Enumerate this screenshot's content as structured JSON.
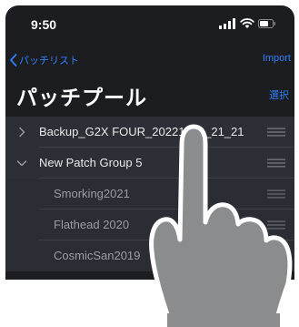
{
  "status": {
    "time": "9:50"
  },
  "nav": {
    "back_label": "パッチリスト",
    "import_label": "Import"
  },
  "header": {
    "title": "パッチプール",
    "select_label": "選択"
  },
  "patches": [
    {
      "label": "Backup_G2X FOUR_20221230_21_21",
      "expanded": false,
      "level": 0
    },
    {
      "label": "New Patch Group 5",
      "expanded": true,
      "level": 0
    },
    {
      "label": "Smorking2021",
      "level": 1
    },
    {
      "label": "Flathead 2020",
      "level": 1
    },
    {
      "label": "CosmicSan2019",
      "level": 1
    }
  ]
}
